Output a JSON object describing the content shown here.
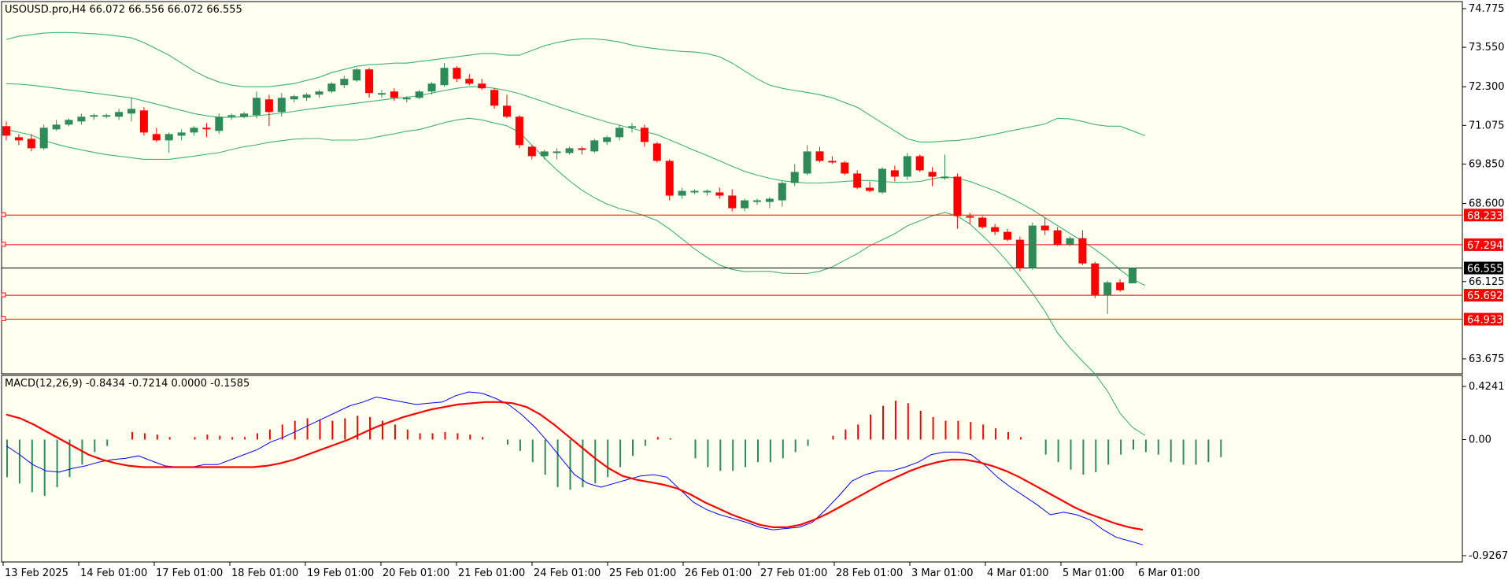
{
  "colors": {
    "background": "#fffff0",
    "bull_candle": "#2e8b57",
    "bear_candle": "#ff0000",
    "bollinger": "#3cb371",
    "level_line": "#ff0000",
    "current_price_line": "#000000",
    "macd_line": "#0000ff",
    "signal_line": "#ff0000"
  },
  "chart_data": [
    {
      "type": "candlestick",
      "title": "USOUSD.pro,H4  66.072 66.556 66.072 66.555",
      "price_axis_ticks": [
        "74.775",
        "73.550",
        "72.300",
        "71.075",
        "69.850",
        "68.600",
        "66.125",
        "63.675"
      ],
      "ylim": [
        63.2,
        75.0
      ],
      "horizontal_levels": [
        {
          "label": "68.233",
          "value": 68.233
        },
        {
          "label": "67.294",
          "value": 67.294
        },
        {
          "label": "65.692",
          "value": 65.692
        },
        {
          "label": "64.933",
          "value": 64.933
        }
      ],
      "current_price": {
        "label": "66.555",
        "value": 66.555
      },
      "candles": [
        [
          71.05,
          71.2,
          70.6,
          70.75
        ],
        [
          70.7,
          70.8,
          70.45,
          70.6
        ],
        [
          70.65,
          70.8,
          70.25,
          70.35
        ],
        [
          70.35,
          71.1,
          70.3,
          71.0
        ],
        [
          70.95,
          71.25,
          70.9,
          71.1
        ],
        [
          71.1,
          71.3,
          71.05,
          71.25
        ],
        [
          71.2,
          71.45,
          71.1,
          71.35
        ],
        [
          71.35,
          71.45,
          71.25,
          71.4
        ],
        [
          71.35,
          71.45,
          71.3,
          71.4
        ],
        [
          71.35,
          71.6,
          71.25,
          71.5
        ],
        [
          71.45,
          71.95,
          71.2,
          71.6
        ],
        [
          71.55,
          71.65,
          70.75,
          70.85
        ],
        [
          70.8,
          71.0,
          70.55,
          70.6
        ],
        [
          70.6,
          70.85,
          70.2,
          70.8
        ],
        [
          70.75,
          70.95,
          70.6,
          70.85
        ],
        [
          70.85,
          71.05,
          70.75,
          71.0
        ],
        [
          71.0,
          71.15,
          70.7,
          70.95
        ],
        [
          70.9,
          71.45,
          70.8,
          71.35
        ],
        [
          71.35,
          71.45,
          71.25,
          71.4
        ],
        [
          71.35,
          71.5,
          71.3,
          71.45
        ],
        [
          71.4,
          72.15,
          71.3,
          71.95
        ],
        [
          71.9,
          72.05,
          71.05,
          71.5
        ],
        [
          71.5,
          72.1,
          71.35,
          71.95
        ],
        [
          71.9,
          72.05,
          71.8,
          72.0
        ],
        [
          71.95,
          72.1,
          71.85,
          72.05
        ],
        [
          72.05,
          72.2,
          71.95,
          72.15
        ],
        [
          72.15,
          72.45,
          72.1,
          72.4
        ],
        [
          72.35,
          72.65,
          72.25,
          72.55
        ],
        [
          72.5,
          72.9,
          72.45,
          72.85
        ],
        [
          72.85,
          72.9,
          71.95,
          72.1
        ],
        [
          72.05,
          72.2,
          71.95,
          72.1
        ],
        [
          72.15,
          72.25,
          71.85,
          71.95
        ],
        [
          71.9,
          72.0,
          71.8,
          71.95
        ],
        [
          71.95,
          72.2,
          71.9,
          72.15
        ],
        [
          72.15,
          72.45,
          72.05,
          72.4
        ],
        [
          72.35,
          73.05,
          72.3,
          72.9
        ],
        [
          72.9,
          72.95,
          72.45,
          72.55
        ],
        [
          72.55,
          72.7,
          72.35,
          72.4
        ],
        [
          72.4,
          72.55,
          72.2,
          72.25
        ],
        [
          72.2,
          72.25,
          71.6,
          71.7
        ],
        [
          71.7,
          72.05,
          71.3,
          71.35
        ],
        [
          71.35,
          71.4,
          70.35,
          70.45
        ],
        [
          70.4,
          70.45,
          70.0,
          70.1
        ],
        [
          70.1,
          70.3,
          70.0,
          70.25
        ],
        [
          70.2,
          70.35,
          70.0,
          70.25
        ],
        [
          70.2,
          70.4,
          70.15,
          70.35
        ],
        [
          70.35,
          70.4,
          70.15,
          70.3
        ],
        [
          70.25,
          70.65,
          70.2,
          70.6
        ],
        [
          70.55,
          70.75,
          70.45,
          70.7
        ],
        [
          70.7,
          71.1,
          70.6,
          71.0
        ],
        [
          71.0,
          71.15,
          70.85,
          71.05
        ],
        [
          71.0,
          71.1,
          70.4,
          70.55
        ],
        [
          70.5,
          70.55,
          69.9,
          69.95
        ],
        [
          69.95,
          70.0,
          68.7,
          68.85
        ],
        [
          68.85,
          69.1,
          68.75,
          69.0
        ],
        [
          68.95,
          69.05,
          68.9,
          69.0
        ],
        [
          68.95,
          69.05,
          68.85,
          69.0
        ],
        [
          68.95,
          69.1,
          68.75,
          68.85
        ],
        [
          68.85,
          69.05,
          68.35,
          68.45
        ],
        [
          68.45,
          68.75,
          68.35,
          68.7
        ],
        [
          68.65,
          68.75,
          68.55,
          68.7
        ],
        [
          68.65,
          68.8,
          68.45,
          68.75
        ],
        [
          68.7,
          69.3,
          68.5,
          69.25
        ],
        [
          69.25,
          69.85,
          69.15,
          69.6
        ],
        [
          69.55,
          70.45,
          69.5,
          70.25
        ],
        [
          70.25,
          70.4,
          69.9,
          69.95
        ],
        [
          69.95,
          70.1,
          69.85,
          69.9
        ],
        [
          69.9,
          69.95,
          69.5,
          69.55
        ],
        [
          69.55,
          69.65,
          69.05,
          69.1
        ],
        [
          69.1,
          69.3,
          68.95,
          69.0
        ],
        [
          68.95,
          69.75,
          68.9,
          69.7
        ],
        [
          69.65,
          69.8,
          69.3,
          69.45
        ],
        [
          69.45,
          70.2,
          69.35,
          70.1
        ],
        [
          70.1,
          70.15,
          69.6,
          69.65
        ],
        [
          69.6,
          69.75,
          69.15,
          69.45
        ],
        [
          69.4,
          70.15,
          69.35,
          69.45
        ],
        [
          69.45,
          69.55,
          67.8,
          68.2
        ],
        [
          68.2,
          68.3,
          67.95,
          68.15
        ],
        [
          68.15,
          68.2,
          67.8,
          67.85
        ],
        [
          67.85,
          67.95,
          67.6,
          67.7
        ],
        [
          67.7,
          67.8,
          67.4,
          67.45
        ],
        [
          67.45,
          67.55,
          66.45,
          66.55
        ],
        [
          66.55,
          68.0,
          66.5,
          67.9
        ],
        [
          67.9,
          68.15,
          67.6,
          67.75
        ],
        [
          67.75,
          67.85,
          67.25,
          67.3
        ],
        [
          67.3,
          67.55,
          67.25,
          67.5
        ],
        [
          67.5,
          67.75,
          66.65,
          66.7
        ],
        [
          66.7,
          66.75,
          65.6,
          65.7
        ],
        [
          65.7,
          66.15,
          65.1,
          66.1
        ],
        [
          66.1,
          66.2,
          65.8,
          65.85
        ],
        [
          66.07,
          66.56,
          66.07,
          66.56
        ]
      ],
      "bollinger_upper": [
        73.8,
        73.9,
        73.95,
        74.0,
        74.02,
        74.02,
        74.0,
        73.98,
        73.95,
        73.9,
        73.85,
        73.7,
        73.5,
        73.3,
        73.05,
        72.8,
        72.6,
        72.45,
        72.35,
        72.3,
        72.3,
        72.3,
        72.35,
        72.4,
        72.5,
        72.6,
        72.75,
        72.85,
        72.95,
        73.0,
        73.02,
        73.05,
        73.05,
        73.1,
        73.15,
        73.2,
        73.25,
        73.3,
        73.35,
        73.35,
        73.3,
        73.3,
        73.45,
        73.6,
        73.7,
        73.78,
        73.82,
        73.82,
        73.78,
        73.72,
        73.62,
        73.55,
        73.5,
        73.45,
        73.42,
        73.4,
        73.35,
        73.25,
        73.05,
        72.8,
        72.55,
        72.35,
        72.25,
        72.18,
        72.12,
        72.05,
        71.95,
        71.8,
        71.65,
        71.4,
        71.15,
        70.9,
        70.65,
        70.55,
        70.55,
        70.58,
        70.6,
        70.65,
        70.72,
        70.8,
        70.88,
        70.96,
        71.04,
        71.12,
        71.3,
        71.28,
        71.2,
        71.1,
        71.05,
        71.05,
        70.9,
        70.75
      ],
      "bollinger_middle": [
        72.4,
        72.38,
        72.35,
        72.3,
        72.25,
        72.2,
        72.15,
        72.1,
        72.05,
        72.0,
        71.95,
        71.85,
        71.75,
        71.65,
        71.55,
        71.45,
        71.38,
        71.33,
        71.33,
        71.35,
        71.38,
        71.42,
        71.47,
        71.52,
        71.58,
        71.63,
        71.68,
        71.73,
        71.78,
        71.83,
        71.88,
        71.93,
        71.97,
        72.02,
        72.1,
        72.18,
        72.25,
        72.3,
        72.3,
        72.25,
        72.18,
        72.08,
        71.95,
        71.82,
        71.68,
        71.55,
        71.42,
        71.3,
        71.18,
        71.08,
        70.98,
        70.88,
        70.78,
        70.62,
        70.45,
        70.28,
        70.12,
        69.95,
        69.78,
        69.62,
        69.5,
        69.4,
        69.32,
        69.28,
        69.25,
        69.25,
        69.27,
        69.3,
        69.33,
        69.33,
        69.3,
        69.27,
        69.27,
        69.3,
        69.38,
        69.45,
        69.4,
        69.3,
        69.15,
        69.0,
        68.82,
        68.62,
        68.4,
        68.15,
        67.9,
        67.65,
        67.4,
        67.15,
        66.85,
        66.5,
        66.2,
        66.0
      ],
      "bollinger_lower": [
        70.95,
        70.86,
        70.77,
        70.6,
        70.48,
        70.38,
        70.3,
        70.22,
        70.15,
        70.1,
        70.05,
        70.0,
        70.0,
        70.0,
        70.05,
        70.1,
        70.16,
        70.21,
        70.31,
        70.4,
        70.46,
        70.54,
        70.59,
        70.64,
        70.66,
        70.66,
        70.61,
        70.61,
        70.61,
        70.66,
        70.74,
        70.81,
        70.89,
        70.94,
        71.05,
        71.16,
        71.25,
        71.3,
        71.25,
        71.15,
        71.06,
        70.86,
        70.45,
        70.04,
        69.66,
        69.32,
        69.02,
        68.78,
        68.58,
        68.44,
        68.34,
        68.21,
        68.06,
        67.79,
        67.48,
        67.16,
        66.89,
        66.65,
        66.51,
        66.44,
        66.45,
        66.45,
        66.39,
        66.38,
        66.38,
        66.45,
        66.59,
        66.8,
        67.01,
        67.26,
        67.45,
        67.64,
        67.89,
        68.05,
        68.21,
        68.32,
        68.2,
        67.95,
        67.58,
        67.2,
        66.76,
        66.28,
        65.76,
        65.18,
        64.5,
        64.02,
        63.6,
        63.2,
        62.65,
        61.95,
        61.5,
        61.25
      ]
    },
    {
      "type": "line_histogram",
      "title": "MACD(12,26,9) -0.8434 -0.7214 0.0000 -0.1585",
      "axis_ticks": [
        "0.4241",
        "0.00",
        "-0.9267"
      ],
      "ylim": [
        -0.9267,
        0.4241
      ],
      "histogram": [
        -0.3,
        -0.35,
        -0.42,
        -0.45,
        -0.38,
        -0.3,
        -0.2,
        -0.1,
        -0.05,
        0.0,
        0.06,
        0.05,
        0.04,
        0.02,
        0.0,
        0.02,
        0.04,
        0.03,
        0.02,
        0.02,
        0.05,
        0.08,
        0.12,
        0.15,
        0.17,
        0.16,
        0.15,
        0.17,
        0.19,
        0.18,
        0.15,
        0.12,
        0.08,
        0.05,
        0.05,
        0.06,
        0.05,
        0.04,
        0.02,
        0.0,
        -0.04,
        -0.09,
        -0.18,
        -0.28,
        -0.38,
        -0.4,
        -0.38,
        -0.35,
        -0.3,
        -0.22,
        -0.13,
        -0.05,
        0.02,
        0.01,
        0.0,
        -0.15,
        -0.22,
        -0.25,
        -0.25,
        -0.22,
        -0.18,
        -0.18,
        -0.15,
        -0.1,
        -0.05,
        0.0,
        0.03,
        0.08,
        0.12,
        0.2,
        0.27,
        0.31,
        0.29,
        0.23,
        0.18,
        0.15,
        0.15,
        0.14,
        0.12,
        0.09,
        0.06,
        0.02,
        0.0,
        -0.12,
        -0.18,
        -0.24,
        -0.28,
        -0.26,
        -0.2,
        -0.12,
        -0.08,
        -0.1,
        -0.12,
        -0.18,
        -0.2,
        -0.2,
        -0.18,
        -0.14
      ],
      "macd": [
        -0.05,
        -0.12,
        -0.2,
        -0.25,
        -0.26,
        -0.23,
        -0.21,
        -0.18,
        -0.16,
        -0.15,
        -0.13,
        -0.17,
        -0.21,
        -0.22,
        -0.22,
        -0.2,
        -0.2,
        -0.16,
        -0.12,
        -0.08,
        -0.02,
        0.02,
        0.07,
        0.12,
        0.17,
        0.22,
        0.27,
        0.3,
        0.34,
        0.32,
        0.3,
        0.28,
        0.29,
        0.3,
        0.35,
        0.38,
        0.37,
        0.33,
        0.28,
        0.2,
        0.1,
        -0.02,
        -0.15,
        -0.28,
        -0.35,
        -0.38,
        -0.35,
        -0.32,
        -0.29,
        -0.28,
        -0.3,
        -0.4,
        -0.5,
        -0.56,
        -0.6,
        -0.63,
        -0.66,
        -0.7,
        -0.72,
        -0.71,
        -0.7,
        -0.66,
        -0.56,
        -0.45,
        -0.33,
        -0.28,
        -0.25,
        -0.25,
        -0.22,
        -0.18,
        -0.12,
        -0.1,
        -0.1,
        -0.12,
        -0.2,
        -0.3,
        -0.38,
        -0.45,
        -0.52,
        -0.6,
        -0.58,
        -0.6,
        -0.64,
        -0.72,
        -0.78,
        -0.81,
        -0.84
      ],
      "signal": [
        0.2,
        0.17,
        0.12,
        0.06,
        0.0,
        -0.06,
        -0.12,
        -0.16,
        -0.19,
        -0.21,
        -0.22,
        -0.22,
        -0.22,
        -0.22,
        -0.22,
        -0.22,
        -0.22,
        -0.22,
        -0.22,
        -0.21,
        -0.19,
        -0.16,
        -0.12,
        -0.08,
        -0.04,
        0.0,
        0.05,
        0.1,
        0.14,
        0.18,
        0.21,
        0.24,
        0.26,
        0.28,
        0.29,
        0.3,
        0.3,
        0.29,
        0.26,
        0.2,
        0.12,
        0.03,
        -0.06,
        -0.15,
        -0.23,
        -0.29,
        -0.32,
        -0.34,
        -0.36,
        -0.39,
        -0.44,
        -0.5,
        -0.55,
        -0.6,
        -0.64,
        -0.68,
        -0.7,
        -0.7,
        -0.68,
        -0.64,
        -0.59,
        -0.53,
        -0.47,
        -0.41,
        -0.35,
        -0.3,
        -0.25,
        -0.21,
        -0.18,
        -0.16,
        -0.16,
        -0.18,
        -0.21,
        -0.25,
        -0.3,
        -0.36,
        -0.42,
        -0.48,
        -0.54,
        -0.59,
        -0.63,
        -0.67,
        -0.7,
        -0.72
      ]
    }
  ],
  "time_axis": [
    "13 Feb 2025",
    "14 Feb 01:00",
    "17 Feb 01:00",
    "18 Feb 01:00",
    "19 Feb 01:00",
    "20 Feb 01:00",
    "21 Feb 01:00",
    "24 Feb 01:00",
    "25 Feb 01:00",
    "26 Feb 01:00",
    "27 Feb 01:00",
    "28 Feb 01:00",
    "3 Mar 01:00",
    "4 Mar 01:00",
    "5 Mar 01:00",
    "6 Mar 01:00"
  ]
}
